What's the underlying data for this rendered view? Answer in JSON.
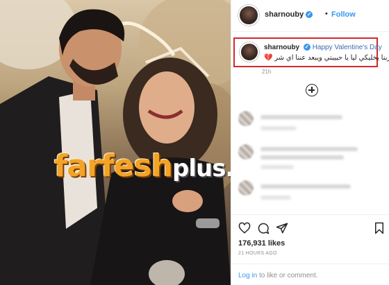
{
  "post": {
    "username": "sharnouby",
    "dot": "•",
    "follow_label": "Follow",
    "verified_mark": "✓"
  },
  "caption": {
    "username": "sharnouby",
    "text": "Happy Valentine's Day",
    "arabic": "ربنا يخليكي ليا يا حبيبتي ويبعد عننا اي شر",
    "heart": "💔",
    "time": "21h"
  },
  "watermark": {
    "part1": "farfesh",
    "part2": "plus.com"
  },
  "engagement": {
    "likes": "176,931 likes",
    "posted": "21 HOURS AGO"
  },
  "login": {
    "link": "Log in",
    "rest": " to like or comment."
  },
  "icons": [
    "heart-icon",
    "comment-icon",
    "share-icon",
    "bookmark-icon",
    "add-icon"
  ],
  "colors": {
    "accent": "#3897f0",
    "highlight_border": "#d6262b",
    "watermark_orange": "#f2a428"
  }
}
